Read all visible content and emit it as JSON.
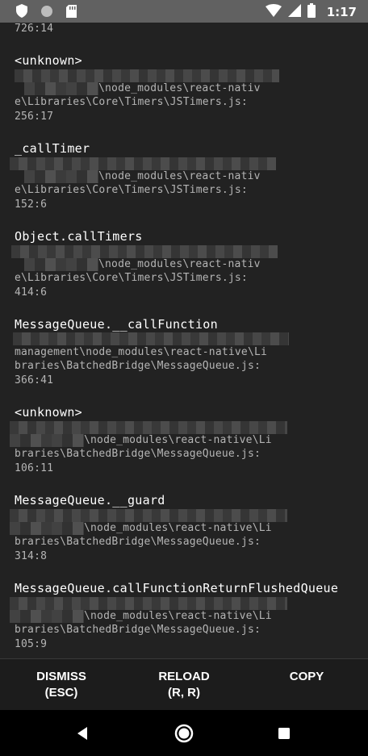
{
  "status_bar": {
    "time": "1:17",
    "left_icons": [
      "shield-icon",
      "circle-icon",
      "sd-card-icon"
    ],
    "right_icons": [
      "wifi-icon",
      "cell-signal-icon",
      "battery-icon"
    ]
  },
  "stack": {
    "top_location": "726:14",
    "frames": [
      {
        "method": "<unknown>",
        "lines": [
          "\\node_modules\\react-nativ",
          "e\\Libraries\\Core\\Timers\\JSTimers.js:",
          "256:17"
        ]
      },
      {
        "method": "_callTimer",
        "lines": [
          "\\node_modules\\react-nativ",
          "e\\Libraries\\Core\\Timers\\JSTimers.js:",
          "152:6"
        ]
      },
      {
        "method": "Object.callTimers",
        "lines": [
          "\\node_modules\\react-nativ",
          "e\\Libraries\\Core\\Timers\\JSTimers.js:",
          "414:6"
        ]
      },
      {
        "method": "MessageQueue.__callFunction",
        "lines": [
          "management\\node_modules\\react-native\\Li",
          "braries\\BatchedBridge\\MessageQueue.js:",
          "366:41"
        ]
      },
      {
        "method": "<unknown>",
        "lines": [
          "\\node_modules\\react-native\\Li",
          "braries\\BatchedBridge\\MessageQueue.js:",
          "106:11"
        ]
      },
      {
        "method": "MessageQueue.__guard",
        "lines": [
          "\\node_modules\\react-native\\Li",
          "braries\\BatchedBridge\\MessageQueue.js:",
          "314:8"
        ]
      },
      {
        "method": "MessageQueue.callFunctionReturnFlushedQueue",
        "lines": [
          "\\node_modules\\react-native\\Li",
          "braries\\BatchedBridge\\MessageQueue.js:",
          "105:9"
        ]
      }
    ]
  },
  "buttons": {
    "dismiss_line1": "DISMISS",
    "dismiss_line2": "(ESC)",
    "reload_line1": "RELOAD",
    "reload_line2": "(R, R)",
    "copy": "COPY"
  },
  "nav": {
    "back": "back-icon",
    "home": "home-icon",
    "recents": "recents-icon"
  },
  "colors": {
    "background": "#222222",
    "status_bar": "#616161",
    "method_text": "#ffffff",
    "location_text": "#b5b5b5"
  }
}
